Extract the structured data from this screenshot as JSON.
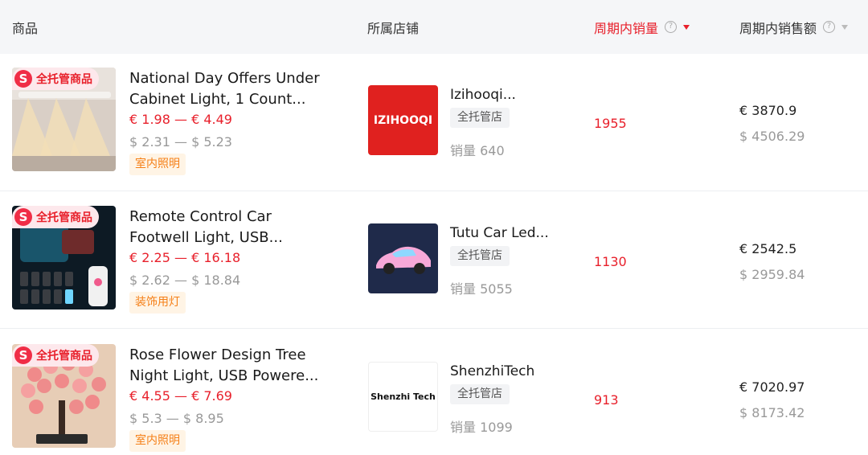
{
  "header": {
    "product": "商品",
    "shop": "所属店铺",
    "period_sales": "周期内销量",
    "period_revenue": "周期内销售额",
    "help_glyph": "?"
  },
  "colors": {
    "accent": "#e8202b",
    "badge_bg": "#fde8ec",
    "tag_orange": "#f57f17",
    "header_bg": "#f5f6f8"
  },
  "badge": {
    "icon": "S",
    "label": "全托管商品"
  },
  "rows": [
    {
      "title_line1": "National Day Offers Under",
      "title_line2": "Cabinet Light, 1 Count...",
      "price_eur": "€ 1.98 — € 4.49",
      "price_usd": "$ 2.31 — $ 5.23",
      "category": "室内照明",
      "shop_name": "Izihooqi...",
      "shop_tag": "全托管店",
      "shop_sales": "销量 640",
      "shop_logo_text": "IZIHOOQI",
      "period_sales": "1955",
      "revenue_eur": "€ 3870.9",
      "revenue_usd": "$ 4506.29"
    },
    {
      "title_line1": "Remote Control Car",
      "title_line2": "Footwell Light, USB...",
      "price_eur": "€ 2.25 — € 16.18",
      "price_usd": "$ 2.62 — $ 18.84",
      "category": "装饰用灯",
      "shop_name": "Tutu Car Led...",
      "shop_tag": "全托管店",
      "shop_sales": "销量 5055",
      "shop_logo_text": "",
      "period_sales": "1130",
      "revenue_eur": "€ 2542.5",
      "revenue_usd": "$ 2959.84"
    },
    {
      "title_line1": "Rose Flower Design Tree",
      "title_line2": "Night Light, USB Powere...",
      "price_eur": "€ 4.55 — € 7.69",
      "price_usd": "$ 5.3 — $ 8.95",
      "category": "室内照明",
      "shop_name": "ShenzhiTech",
      "shop_tag": "全托管店",
      "shop_sales": "销量 1099",
      "shop_logo_text": "Shenzhi Tech",
      "period_sales": "913",
      "revenue_eur": "€ 7020.97",
      "revenue_usd": "$ 8173.42"
    }
  ]
}
